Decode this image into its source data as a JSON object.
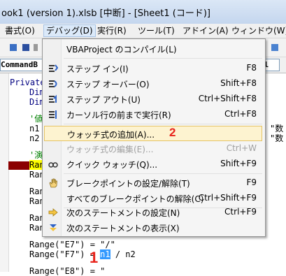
{
  "window": {
    "title": "ook1 (version 1).xlsb [中断] - [Sheet1 (コード)]"
  },
  "menubar": [
    {
      "label": "書式(O)"
    },
    {
      "label": "デバッグ(D)"
    },
    {
      "label": "実行(R)"
    },
    {
      "label": "ツール(T)"
    },
    {
      "label": "アドイン(A)"
    },
    {
      "label": "ウィンドウ(W)"
    }
  ],
  "object_combo": {
    "value": "CommandB"
  },
  "proc_combo": {
    "value": "Cl"
  },
  "code": {
    "line1": "Private",
    "line2": "Dim",
    "line3": "Dim",
    "line4": "'値",
    "line5": "n1",
    "line6": "n2",
    "line7": "'演",
    "line8": "Ran",
    "line9": "Ran",
    "line10": "Ran",
    "line11": "Ran",
    "line12": "Ran",
    "line13": "Ran",
    "line14": "Range(\"E7\") = \"/\"",
    "line15_a": "Range(\"F7\") = ",
    "line15_sel": "n1",
    "line15_b": " / n2",
    "line16": "Range(\"E8\") = \"",
    "right1": "\"数",
    "right2": "\"数"
  },
  "debug_menu": {
    "items": [
      {
        "label": "VBAProject のコンパイル(L)",
        "shortcut": ""
      },
      {
        "label": "ステップ イン(I)",
        "shortcut": "F8"
      },
      {
        "label": "ステップ オーバー(O)",
        "shortcut": "Shift+F8"
      },
      {
        "label": "ステップ アウト(U)",
        "shortcut": "Ctrl+Shift+F8"
      },
      {
        "label": "カーソル行の前まで実行(R)",
        "shortcut": "Ctrl+F8"
      },
      {
        "label": "ウォッチ式の追加(A)...",
        "shortcut": ""
      },
      {
        "label": "ウォッチ式の編集(E)...",
        "shortcut": "Ctrl+W"
      },
      {
        "label": "クイック ウォッチ(Q)...",
        "shortcut": "Shift+F9"
      },
      {
        "label": "ブレークポイントの設定/解除(T)",
        "shortcut": "F9"
      },
      {
        "label": "すべてのブレークポイントの解除(C)",
        "shortcut": "Ctrl+Shift+F9"
      },
      {
        "label": "次のステートメントの設定(N)",
        "shortcut": "Ctrl+F9"
      },
      {
        "label": "次のステートメントの表示(X)",
        "shortcut": ""
      }
    ]
  },
  "annotations": {
    "step2": "2",
    "step1": "1"
  },
  "colors": {
    "highlight": "#fdf3d0",
    "annotation": "#e8231b",
    "breakpoint": "#8b0000"
  }
}
